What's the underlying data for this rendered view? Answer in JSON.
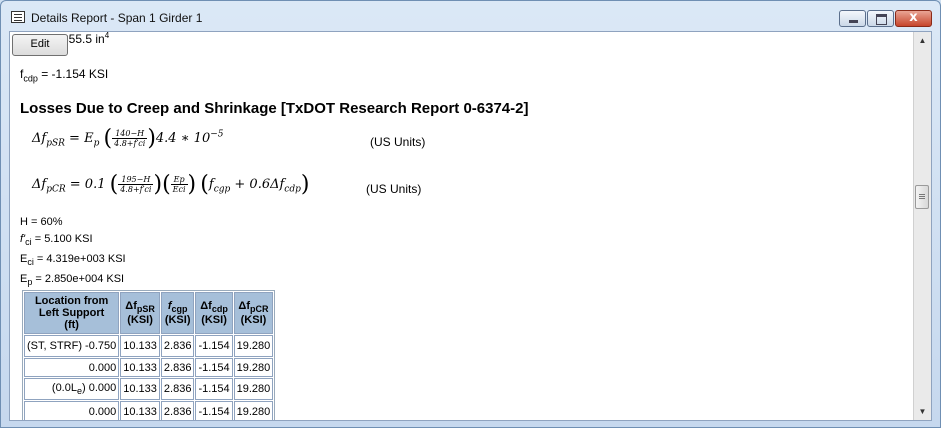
{
  "window": {
    "title": "Details Report - Span 1 Girder 1",
    "close_glyph": "x"
  },
  "toolbar": {
    "edit_label": "Edit"
  },
  "report": {
    "fragment_text": "355.5 in",
    "fragment_sup": "4",
    "fcdp_sym": "f",
    "fcdp_sub": "cdp",
    "fcdp_value": " = -1.154 KSI",
    "section_title": "Losses Due to Creep and Shrinkage [TxDOT Research Report 0-6374-2]",
    "eq1": {
      "lhs": "Δf",
      "lhs_sub": "pSR",
      "mid": " = E",
      "mid_sub": "p",
      "num": "140−H",
      "den": "4.8+f′ci",
      "rest": "4.4 ∗ 10",
      "exp": "−5",
      "units": "(US Units)"
    },
    "eq2": {
      "lhs": "Δf",
      "lhs_sub": "pCR",
      "mid": " = 0.1",
      "num": "195−H",
      "den": "4.8+f′ci",
      "num2": "Ep",
      "den2": "Eci",
      "rest": "f",
      "rest_sub": "cgp",
      "rest2": " + 0.6Δf",
      "rest2_sub": "cdp",
      "units": "(US Units)"
    },
    "params": [
      {
        "sym": "H",
        "sub": "",
        "value": " = 60%"
      },
      {
        "sym": "f'",
        "sub": "ci",
        "value": " = 5.100 KSI"
      },
      {
        "sym": "E",
        "sub": "ci",
        "value": " = 4.319e+003 KSI"
      },
      {
        "sym": "E",
        "sub": "p",
        "value": " = 2.850e+004 KSI"
      }
    ],
    "table": {
      "headers": [
        {
          "line1": "Location from",
          "line2": "Left Support",
          "line3": "(ft)"
        },
        {
          "sym": "Δf",
          "sub": "pSR",
          "unit": "(KSI)"
        },
        {
          "sym": "f",
          "sub": "cgp",
          "unit": "(KSI)"
        },
        {
          "sym": "Δf",
          "sub": "cdp",
          "unit": "(KSI)"
        },
        {
          "sym": "Δf",
          "sub": "pCR",
          "unit": "(KSI)"
        }
      ],
      "rows": [
        {
          "loc": "(ST, STRF) -0.750",
          "c1": "10.133",
          "c2": "2.836",
          "c3": "-1.154",
          "c4": "19.280"
        },
        {
          "loc": "0.000",
          "c1": "10.133",
          "c2": "2.836",
          "c3": "-1.154",
          "c4": "19.280"
        },
        {
          "loc_pre": "(0.0L",
          "loc_sub": "e",
          "loc_post": ") 0.000",
          "c1": "10.133",
          "c2": "2.836",
          "c3": "-1.154",
          "c4": "19.280"
        },
        {
          "loc": "0.000",
          "c1": "10.133",
          "c2": "2.836",
          "c3": "-1.154",
          "c4": "19.280"
        }
      ]
    }
  },
  "scrollbar": {
    "up_glyph": "▲",
    "down_glyph": "▼"
  }
}
